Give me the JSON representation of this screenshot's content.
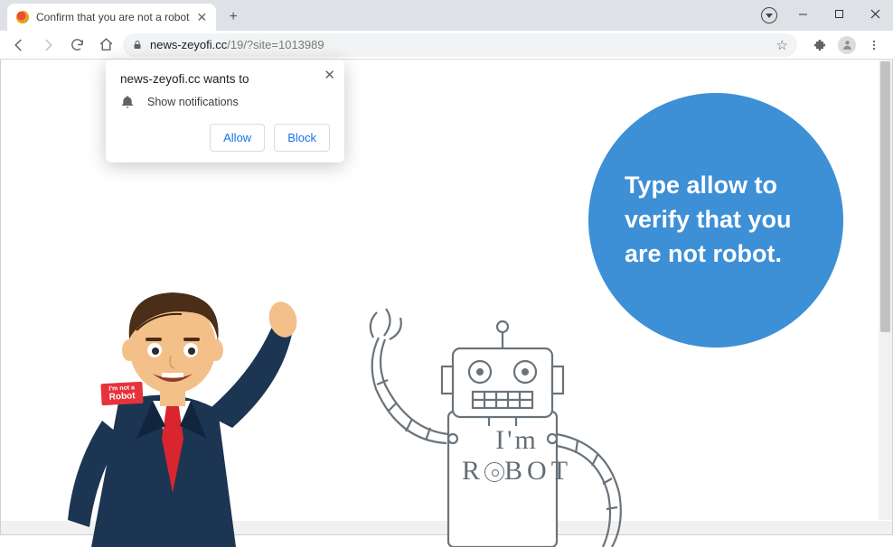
{
  "window": {
    "tab_title": "Confirm that you are not a robot"
  },
  "address": {
    "host": "news-zeyofi.cc",
    "path": "/19/?site=1013989"
  },
  "notification": {
    "title": "news-zeyofi.cc wants to",
    "body": "Show notifications",
    "allow": "Allow",
    "block": "Block"
  },
  "bubble": {
    "text": "Type allow to verify that you are not robot."
  },
  "badge": {
    "line1": "I'm not a",
    "line2": "Robot"
  },
  "robot_label": {
    "line1": "I'm",
    "line2_prefix": "R",
    "line2_suffix": "BOT"
  }
}
